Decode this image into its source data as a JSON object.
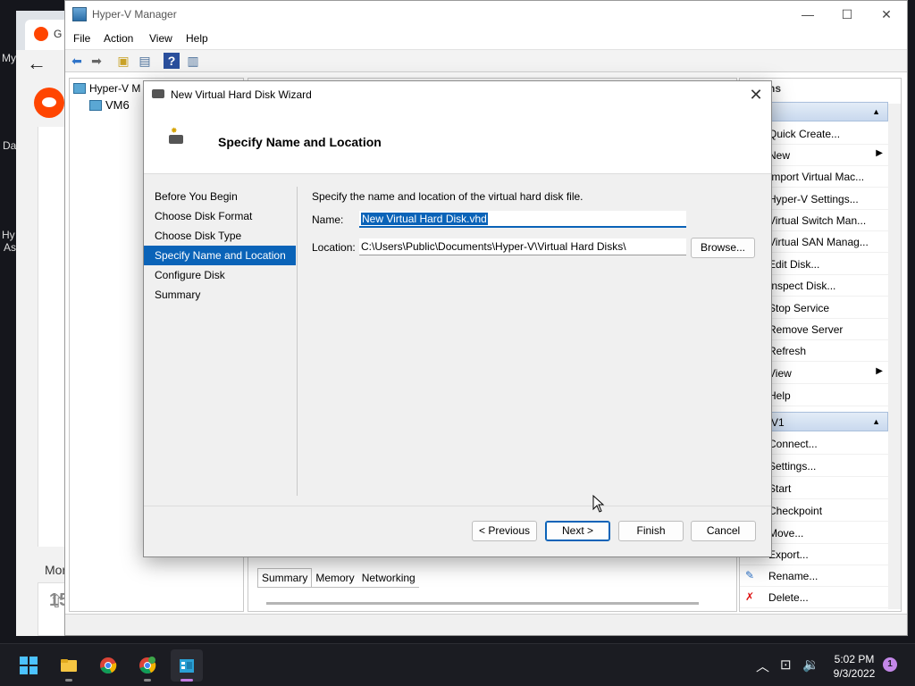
{
  "background": {
    "browser_tab_initial": "G",
    "more_text": "Mor",
    "count_text": "15",
    "desktop_labels": [
      "My",
      "Da",
      "Hy",
      "As"
    ]
  },
  "hyperv": {
    "title": "Hyper-V Manager",
    "menu": [
      "File",
      "Action",
      "View",
      "Help"
    ],
    "tree": {
      "root": "Hyper-V M",
      "child": "VM6"
    },
    "tabs": [
      "Summary",
      "Memory",
      "Networking"
    ],
    "actions": {
      "header": "ns",
      "group1": "",
      "items1": [
        "Quick Create...",
        "New",
        "Import Virtual Mac...",
        "Hyper-V Settings...",
        "Virtual Switch Man...",
        "Virtual SAN Manag...",
        "Edit Disk...",
        "Inspect Disk...",
        "Stop Service",
        "Remove Server",
        "Refresh",
        "View",
        "Help"
      ],
      "group2": "V1",
      "items2": [
        "Connect...",
        "Settings...",
        "Start",
        "Checkpoint",
        "Move...",
        "Export...",
        "Rename...",
        "Delete..."
      ]
    }
  },
  "wizard": {
    "title": "New Virtual Hard Disk Wizard",
    "heading": "Specify Name and Location",
    "steps": [
      "Before You Begin",
      "Choose Disk Format",
      "Choose Disk Type",
      "Specify Name and Location",
      "Configure Disk",
      "Summary"
    ],
    "active_step": 3,
    "description": "Specify the name and location of the virtual hard disk file.",
    "name_label": "Name:",
    "name_value": "New Virtual Hard Disk.vhd",
    "location_label": "Location:",
    "location_value": "C:\\Users\\Public\\Documents\\Hyper-V\\Virtual Hard Disks\\",
    "browse_label": "Browse...",
    "buttons": {
      "previous": "< Previous",
      "next": "Next >",
      "finish": "Finish",
      "cancel": "Cancel"
    }
  },
  "taskbar": {
    "time": "5:02 PM",
    "date": "9/3/2022",
    "notification_count": "1"
  },
  "colors": {
    "accent": "#0a63b8",
    "taskbar": "#1b1c22"
  }
}
